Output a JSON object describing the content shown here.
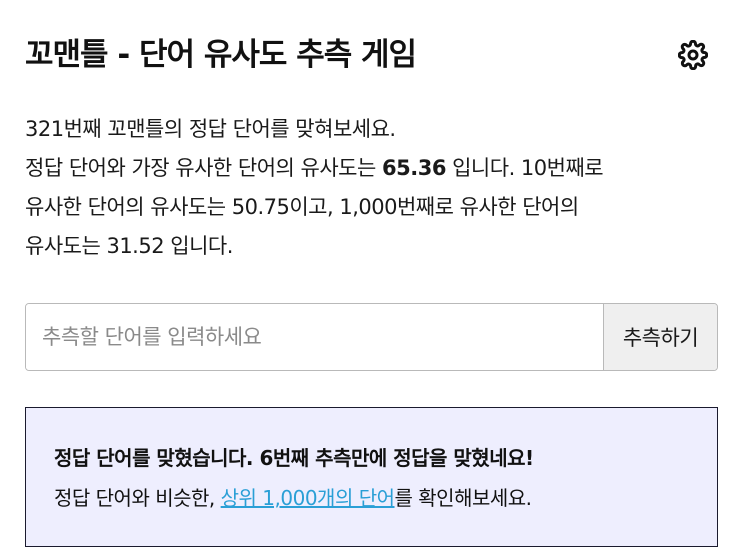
{
  "header": {
    "title": "꼬맨틀 - 단어 유사도 추측 게임",
    "settings_icon": "gear-icon"
  },
  "intro": {
    "line1": "321번째 꼬맨틀의 정답 단어를 맞혀보세요.",
    "line2_prefix": "정답 단어와 가장 유사한 단어의 유사도는 ",
    "top_similarity": "65.36",
    "line2_suffix": " 입니다. 10번째로",
    "line3": "유사한 단어의 유사도는 50.75이고, 1,000번째로 유사한 단어의",
    "line4": "유사도는 31.52 입니다."
  },
  "guess": {
    "placeholder": "추측할 단어를 입력하세요",
    "value": "",
    "button_label": "추측하기"
  },
  "result": {
    "headline": "정답 단어를 맞혔습니다. 6번째 추측만에 정답을 맞혔네요!",
    "text_prefix": "정답 단어와 비슷한, ",
    "link_label": "상위 1,000개의 단어",
    "text_suffix": "를 확인해보세요."
  },
  "colors": {
    "result_background": "#eeeefe",
    "link": "#2a9fd6",
    "button_background": "#efefef"
  }
}
